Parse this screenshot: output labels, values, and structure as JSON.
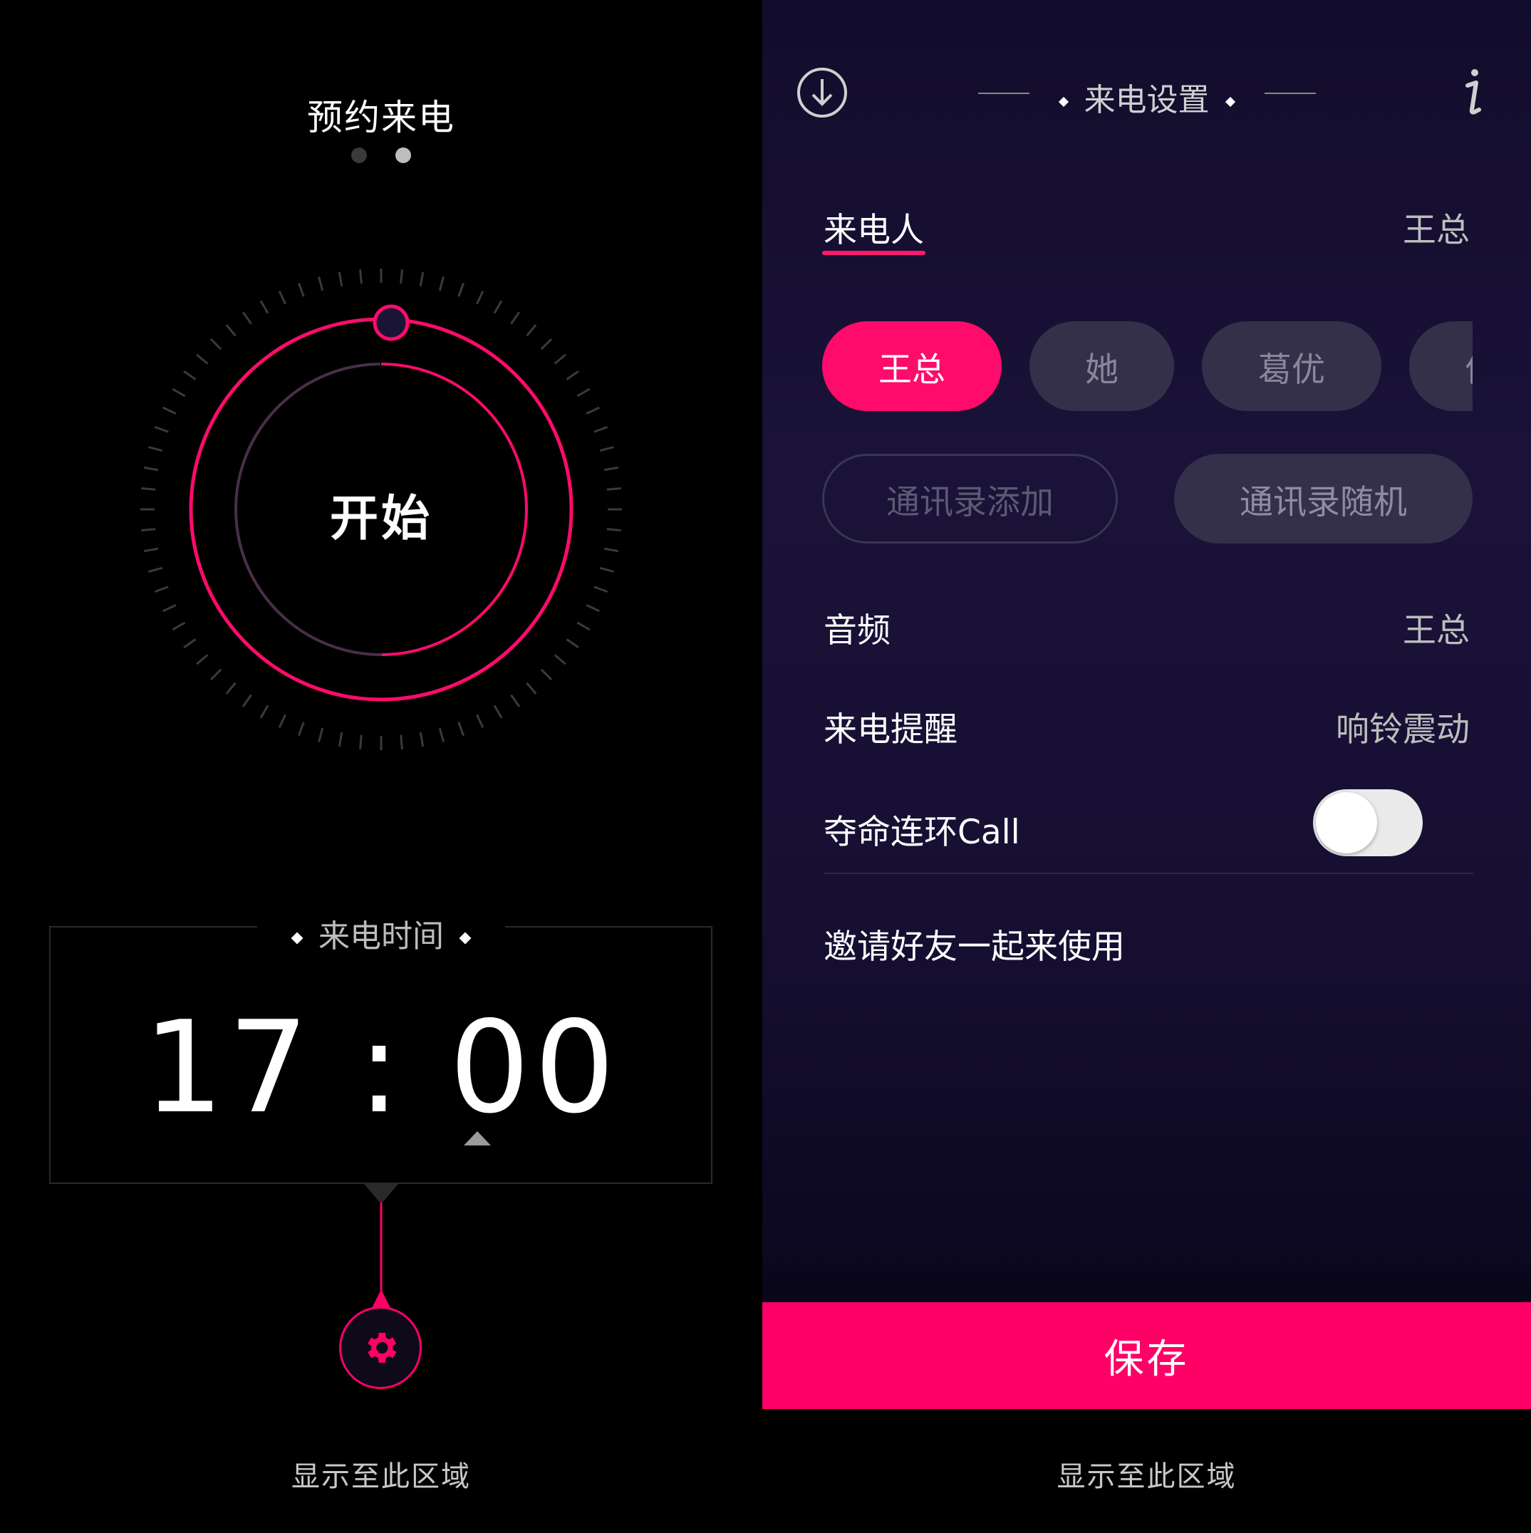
{
  "left": {
    "title": "预约来电",
    "start_label": "开始",
    "time_header": "来电时间",
    "time_value": "17 : 00",
    "hint": "显示至此区域"
  },
  "right": {
    "title": "来电设置",
    "caller_label": "来电人",
    "caller_value": "王总",
    "chips": [
      "王总",
      "她",
      "葛优",
      "何"
    ],
    "contact_add": "通讯录添加",
    "contact_random": "通讯录随机",
    "audio_label": "音频",
    "audio_value": "王总",
    "reminder_label": "来电提醒",
    "reminder_value": "响铃震动",
    "loop_call_label": "夺命连环Call",
    "loop_call_enabled": false,
    "invite_label": "邀请好友一起来使用",
    "save_label": "保存",
    "hint": "显示至此区域"
  },
  "colors": {
    "accent": "#ff0066",
    "panel_bg": "#1a1238",
    "chip_off": "#34304a"
  },
  "icons": {
    "download": "download-circle-icon",
    "info": "info-icon",
    "settings": "gear-icon"
  }
}
